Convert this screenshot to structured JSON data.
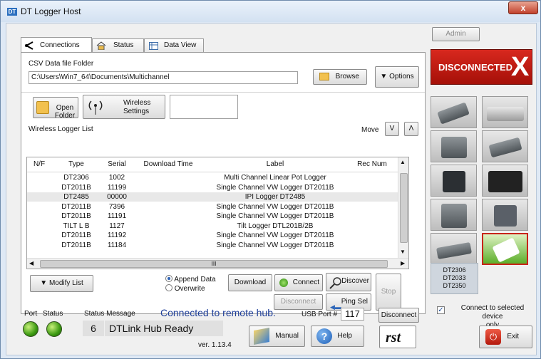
{
  "window": {
    "title": "DT Logger Host",
    "logo_text": "DT",
    "close_glyph": "x"
  },
  "tabs": [
    {
      "label": "Connections",
      "icon": "connections-icon"
    },
    {
      "label": "Status",
      "icon": "home-icon"
    },
    {
      "label": "Data View",
      "icon": "table-icon"
    }
  ],
  "csv": {
    "group_label": "CSV Data file Folder",
    "path": "C:\\Users\\Win7_64\\Documents\\Multichannel",
    "browse_label": "Browse",
    "options_label": "Options"
  },
  "toolbar": {
    "open_folder_label": "Open Folder",
    "wireless_settings_line1": "Wireless",
    "wireless_settings_line2": "Settings"
  },
  "list": {
    "group_label": "Wireless Logger List",
    "move_label": "Move",
    "move_down": "V",
    "move_up": "Λ",
    "columns": [
      "N/F",
      "Type",
      "Serial",
      "Download Time",
      "Label",
      "Rec Num"
    ],
    "rows": [
      {
        "type": "DT2306",
        "serial": "1002",
        "download": "",
        "label": "Multi Channel Linear Pot Logger",
        "rec": "",
        "selected": false
      },
      {
        "type": "DT2011B",
        "serial": "11199",
        "download": "",
        "label": "Single Channel VW Logger DT2011B",
        "rec": "",
        "selected": false
      },
      {
        "type": "DT2485",
        "serial": "00000",
        "download": "",
        "label": "IPI Logger DT2485",
        "rec": "",
        "selected": true
      },
      {
        "type": "DT2011B",
        "serial": "7396",
        "download": "",
        "label": "Single Channel VW Logger DT2011B",
        "rec": "",
        "selected": false
      },
      {
        "type": "DT2011B",
        "serial": "11191",
        "download": "",
        "label": "Single Channel VW Logger DT2011B",
        "rec": "",
        "selected": false
      },
      {
        "type": "TILT L B",
        "serial": "1127",
        "download": "",
        "label": "Tilt Logger DTL201B/2B",
        "rec": "",
        "selected": false
      },
      {
        "type": "DT2011B",
        "serial": "11192",
        "download": "",
        "label": "Single Channel VW Logger DT2011B",
        "rec": "",
        "selected": false
      },
      {
        "type": "DT2011B",
        "serial": "11184",
        "download": "",
        "label": "Single Channel VW Logger DT2011B",
        "rec": "",
        "selected": false
      }
    ],
    "hscroll_mid": "III"
  },
  "actions": {
    "modify_list": "Modify List",
    "append": "Append Data",
    "overwrite": "Overwrite",
    "download": "Download",
    "connect": "Connect",
    "discover": "Discover",
    "disconnect": "Disconnect",
    "ping_sel": "Ping Sel",
    "stop": "Stop"
  },
  "side": {
    "admin": "Admin",
    "disconnected": "DISCONNECTED",
    "x_mark": "X",
    "device_list": [
      "DT2306",
      "DT2033",
      "DT2350"
    ]
  },
  "status": {
    "port_label": "Port",
    "status_label": "Status",
    "message_label": "Status Message",
    "remote_text": "Connected to remote hub.",
    "usb_label": "USB Port #",
    "usb_value": "117",
    "disconnect_label": "Disconnect",
    "code": "6",
    "message": "DTLink Hub Ready",
    "manual_label": "Manual",
    "help_label": "Help",
    "version": "ver.  1.13.4",
    "rst_logo": "rst",
    "connect_only_line1": "Connect to selected device",
    "connect_only_line2": "only",
    "exit_label": "Exit"
  },
  "colors": {
    "accent": "#1f3f99",
    "disconnected_bg": "#c41a12",
    "selected_row": "#e8e8e8"
  }
}
